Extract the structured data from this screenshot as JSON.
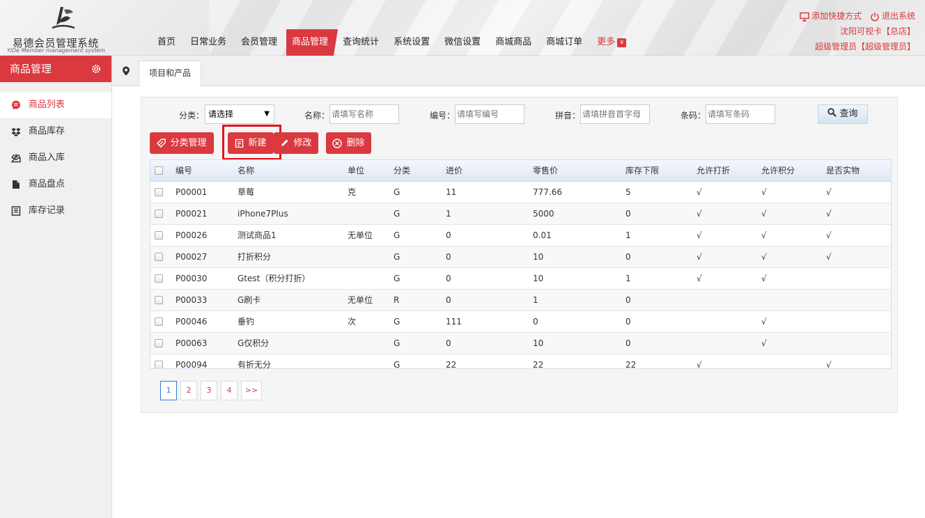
{
  "app": {
    "title": "易德会员管理系统",
    "subtitle": "YiDe Member management system"
  },
  "nav": {
    "items": [
      {
        "label": "首页"
      },
      {
        "label": "日常业务"
      },
      {
        "label": "会员管理"
      },
      {
        "label": "商品管理",
        "active": true
      },
      {
        "label": "查询统计"
      },
      {
        "label": "系统设置"
      },
      {
        "label": "微信设置"
      },
      {
        "label": "商城商品"
      },
      {
        "label": "商城订单"
      }
    ],
    "more_label": "更多"
  },
  "topright": {
    "shortcut": "添加快捷方式",
    "logout": "退出系统",
    "store": "沈阳可视卡【总店】",
    "user": "超级管理员【超级管理员】"
  },
  "sidebar": {
    "title": "商品管理",
    "items": [
      {
        "label": "商品列表",
        "icon": "list-bubble-icon",
        "active": true
      },
      {
        "label": "商品库存",
        "icon": "dropbox-icon"
      },
      {
        "label": "商品入库",
        "icon": "inbox-icon"
      },
      {
        "label": "商品盘点",
        "icon": "file-icon"
      },
      {
        "label": "库存记录",
        "icon": "book-icon"
      }
    ]
  },
  "tab": {
    "label": "项目和产品"
  },
  "filters": {
    "category_label": "分类：",
    "category_value": "请选择",
    "name_label": "名称：",
    "name_placeholder": "请填写名称",
    "code_label": "编号：",
    "code_placeholder": "请填写编号",
    "pinyin_label": "拼音：",
    "pinyin_placeholder": "请填拼音首字母",
    "barcode_label": "条码：",
    "barcode_placeholder": "请填写条码",
    "query_label": "查询"
  },
  "actions": {
    "category_manage": "分类管理",
    "new": "新建",
    "edit": "修改",
    "delete": "删除"
  },
  "table": {
    "headers": [
      "编号",
      "名称",
      "单位",
      "分类",
      "进价",
      "零售价",
      "库存下限",
      "允许打折",
      "允许积分",
      "是否实物"
    ],
    "rows": [
      [
        "P00001",
        "草莓",
        "克",
        "G",
        "11",
        "777.66",
        "5",
        "√",
        "√",
        "√"
      ],
      [
        "P00021",
        "iPhone7Plus",
        "",
        "G",
        "1",
        "5000",
        "0",
        "√",
        "√",
        "√"
      ],
      [
        "P00026",
        "测试商品1",
        "无单位",
        "G",
        "0",
        "0.01",
        "1",
        "√",
        "√",
        "√"
      ],
      [
        "P00027",
        "打折积分",
        "",
        "G",
        "0",
        "10",
        "0",
        "√",
        "√",
        "√"
      ],
      [
        "P00030",
        "Gtest（积分打折）",
        "",
        "G",
        "0",
        "10",
        "1",
        "√",
        "√",
        ""
      ],
      [
        "P00033",
        "G刷卡",
        "无单位",
        "R",
        "0",
        "1",
        "0",
        "",
        "",
        ""
      ],
      [
        "P00046",
        "垂钓",
        "次",
        "G",
        "111",
        "0",
        "0",
        "",
        "√",
        ""
      ],
      [
        "P00063",
        "G仅积分",
        "",
        "G",
        "0",
        "10",
        "0",
        "",
        "√",
        ""
      ],
      [
        "P00094",
        "有折无分",
        "",
        "G",
        "22",
        "22",
        "22",
        "√",
        "",
        "√"
      ]
    ]
  },
  "pager": {
    "pages": [
      "1",
      "2",
      "3",
      "4"
    ],
    "current": "1",
    "next": ">>"
  }
}
